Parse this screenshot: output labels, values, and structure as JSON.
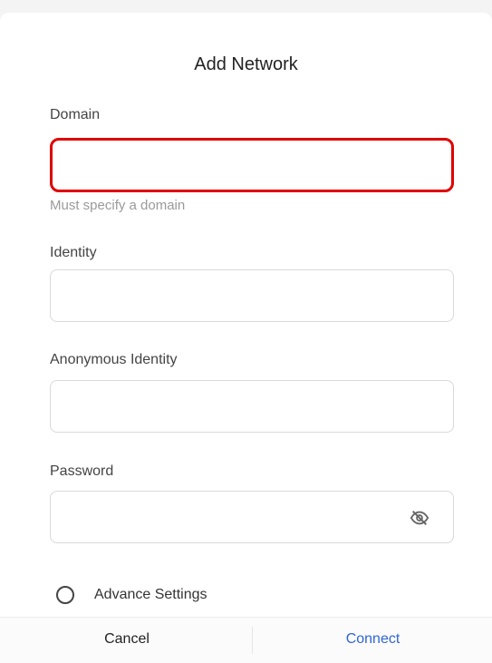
{
  "dialog": {
    "title": "Add Network",
    "domain": {
      "label": "Domain",
      "value": "",
      "helper": "Must specify a domain"
    },
    "identity": {
      "label": "Identity",
      "value": ""
    },
    "anonymous_identity": {
      "label": "Anonymous Identity",
      "value": ""
    },
    "password": {
      "label": "Password",
      "value": "",
      "toggle_icon": "eye-off-icon"
    },
    "advance_settings": {
      "label": "Advance Settings",
      "checked": false
    },
    "footer": {
      "cancel_label": "Cancel",
      "connect_label": "Connect"
    }
  },
  "colors": {
    "error_border": "#e00000",
    "connect_text": "#2f66d6",
    "helper_text": "#9a9a9a"
  }
}
